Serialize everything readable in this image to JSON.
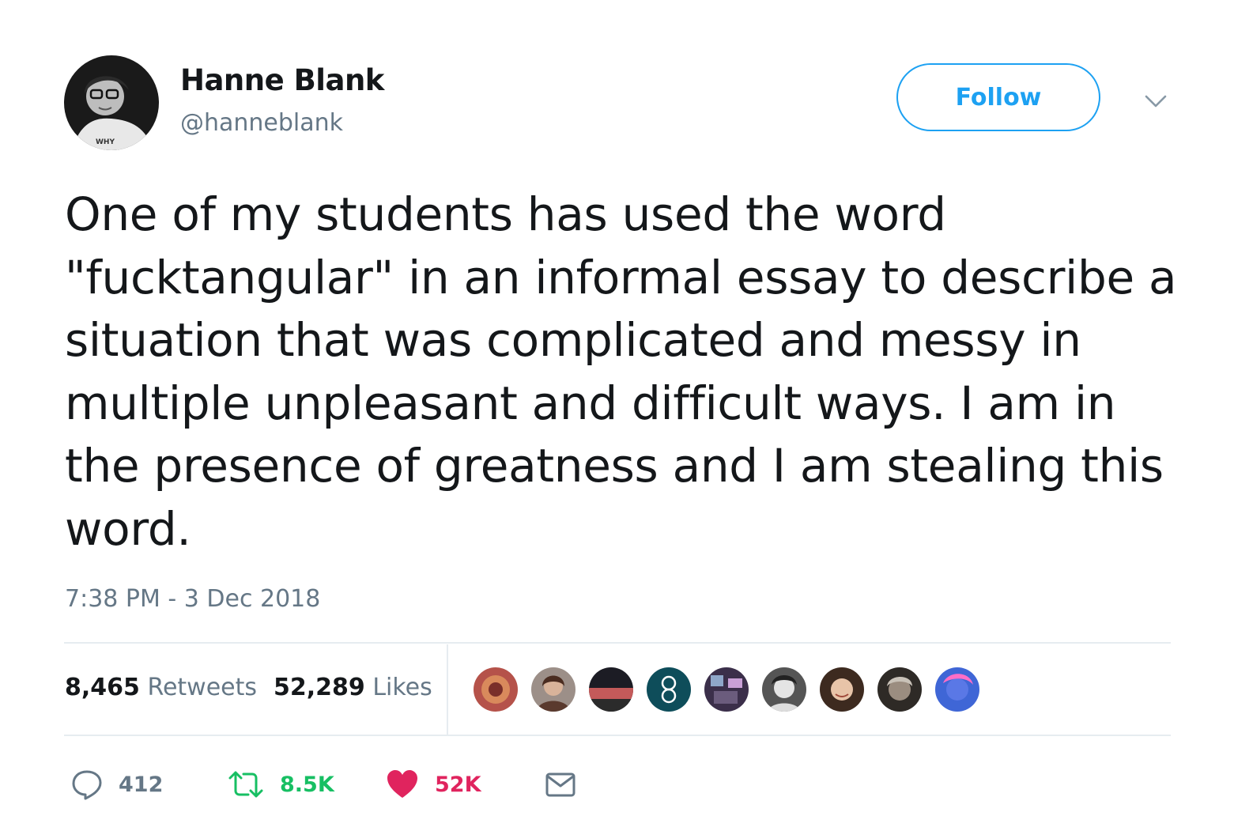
{
  "author": {
    "name": "Hanne Blank",
    "handle": "@hanneblank",
    "avatar_icon": "user-avatar",
    "avatar_shirt_text": "WHY"
  },
  "follow_label": "Follow",
  "tweet": {
    "text": "One of my students has used the word \"fucktangular\" in an informal essay to describe a situation that was complicated and messy in multiple unpleasant and difficult ways.  I am in the presence of greatness and I am stealing this word.",
    "timestamp": "7:38 PM - 3 Dec 2018"
  },
  "stats": {
    "retweets_count": "8,465",
    "retweets_label": "Retweets",
    "likes_count": "52,289",
    "likes_label": "Likes"
  },
  "actions": {
    "reply_count": "412",
    "retweet_count": "8.5K",
    "like_count": "52K"
  },
  "colors": {
    "accent": "#1da1f2",
    "muted": "#657786",
    "retweet": "#17bf63",
    "like": "#e0245e",
    "divider": "#e6ecf0"
  }
}
